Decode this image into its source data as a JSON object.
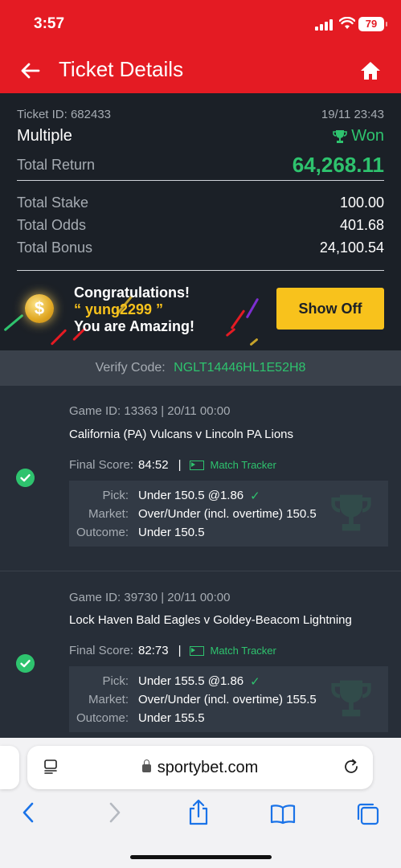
{
  "status_bar": {
    "time": "3:57",
    "battery": "79"
  },
  "header": {
    "title": "Ticket Details"
  },
  "ticket": {
    "id_label": "Ticket ID: 682433",
    "datetime": "19/11 23:43",
    "type": "Multiple",
    "status": "Won",
    "total_return_label": "Total Return",
    "total_return": "64,268.11",
    "total_stake_label": "Total Stake",
    "total_stake": "100.00",
    "total_odds_label": "Total Odds",
    "total_odds": "401.68",
    "total_bonus_label": "Total Bonus",
    "total_bonus": "24,100.54"
  },
  "promo": {
    "line1": "Congratulations!",
    "username": "“ yung2299 ”",
    "line3": "You are Amazing!",
    "button": "Show Off"
  },
  "verify": {
    "label": "Verify Code:",
    "code": "NGLT14446HL1E52H8"
  },
  "games": [
    {
      "game_id": "Game ID: 13363 | 20/11 00:00",
      "teams": "California (PA) Vulcans v Lincoln PA Lions",
      "final_score_label": "Final Score:",
      "final_score": "84:52",
      "tracker": "Match Tracker",
      "pick_label": "Pick:",
      "pick": "Under 150.5 @1.86",
      "market_label": "Market:",
      "market": "Over/Under (incl. overtime) 150.5",
      "outcome_label": "Outcome:",
      "outcome": "Under 150.5"
    },
    {
      "game_id": "Game ID: 39730 | 20/11 00:00",
      "teams": "Lock Haven Bald Eagles v Goldey-Beacom Lightning",
      "final_score_label": "Final Score:",
      "final_score": "82:73",
      "tracker": "Match Tracker",
      "pick_label": "Pick:",
      "pick": "Under 155.5 @1.86",
      "market_label": "Market:",
      "market": "Over/Under (incl. overtime) 155.5",
      "outcome_label": "Outcome:",
      "outcome": "Under 155.5"
    }
  ],
  "browser": {
    "url": "sportybet.com"
  },
  "colors": {
    "brand_red": "#e41b23",
    "won_green": "#2ec36e",
    "accent_yellow": "#f8c21c"
  },
  "icons": [
    "back-arrow-icon",
    "home-icon",
    "trophy-icon",
    "coin-icon",
    "check-circle-icon",
    "match-tracker-icon",
    "lock-icon",
    "reader-icon",
    "reload-icon",
    "nav-back-icon",
    "nav-forward-icon",
    "share-icon",
    "bookmarks-icon",
    "tabs-icon"
  ]
}
